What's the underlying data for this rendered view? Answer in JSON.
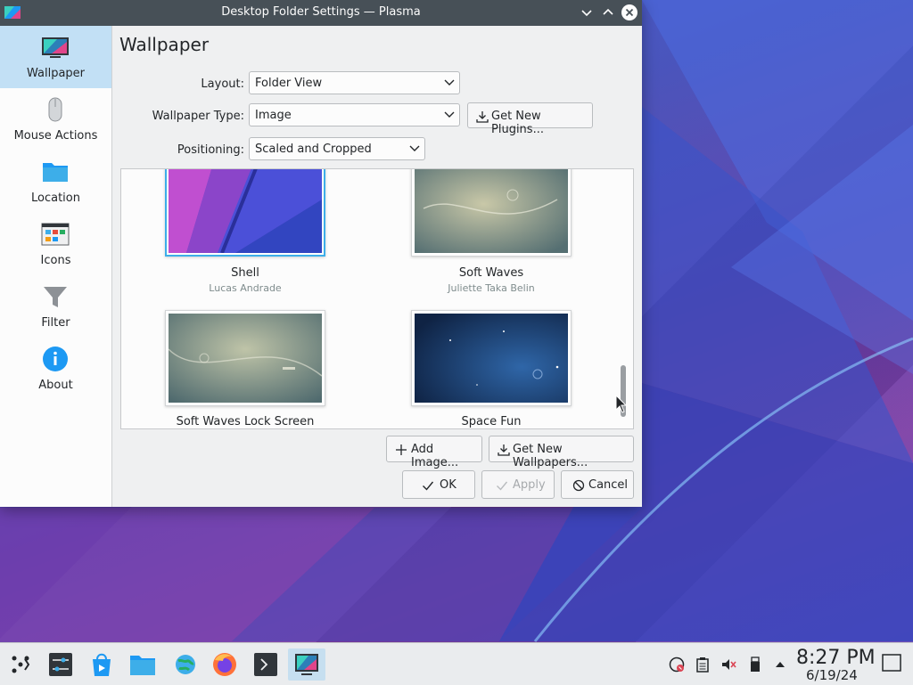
{
  "window": {
    "title": "Desktop Folder Settings — Plasma",
    "minimize_icon": "chevron-down-icon",
    "maximize_icon": "chevron-up-icon",
    "close_icon": "close-icon"
  },
  "sidebar": {
    "items": [
      {
        "label": "Wallpaper",
        "icon": "wallpaper-icon",
        "active": true
      },
      {
        "label": "Mouse Actions",
        "icon": "mouse-icon"
      },
      {
        "label": "Location",
        "icon": "folder-icon"
      },
      {
        "label": "Icons",
        "icon": "icons-icon"
      },
      {
        "label": "Filter",
        "icon": "filter-icon"
      },
      {
        "label": "About",
        "icon": "info-icon"
      }
    ]
  },
  "page": {
    "title": "Wallpaper",
    "layout_label": "Layout:",
    "layout_value": "Folder View",
    "type_label": "Wallpaper Type:",
    "type_value": "Image",
    "get_plugins": "Get New Plugins...",
    "positioning_label": "Positioning:",
    "positioning_value": "Scaled and Cropped",
    "add_image": "Add Image...",
    "get_wallpapers": "Get New Wallpapers..."
  },
  "wallpapers": [
    {
      "name": "Shell",
      "author": "Lucas Andrade",
      "selected": true
    },
    {
      "name": "Soft Waves",
      "author": "Juliette Taka Belin"
    },
    {
      "name": "Soft Waves Lock Screen",
      "author": ""
    },
    {
      "name": "Space Fun",
      "author": ""
    }
  ],
  "dialog_buttons": {
    "ok": "OK",
    "apply": "Apply",
    "cancel": "Cancel"
  },
  "taskbar": {
    "apps": [
      "launcher-icon",
      "system-settings-icon",
      "discover-icon",
      "dolphin-icon",
      "browser-globe-icon",
      "firefox-icon",
      "terminal-icon",
      "plasma-settings-icon"
    ],
    "tray": [
      "network-icon",
      "clipboard-icon",
      "volume-muted-icon",
      "usb-drive-icon",
      "expand-tray-icon"
    ],
    "time": "8:27 PM",
    "date": "6/19/24",
    "show_desktop_icon": "show-desktop-icon"
  },
  "colors": {
    "accent": "#3daee9",
    "titlebar": "#475057",
    "window_bg": "#eff0f1"
  }
}
